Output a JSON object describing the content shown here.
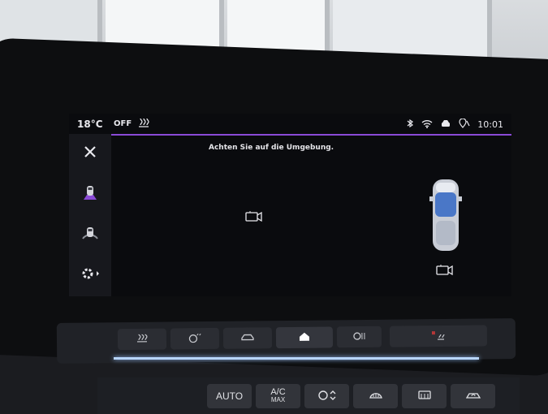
{
  "statusbar": {
    "temperature": "18°C",
    "mode": "OFF",
    "time": "10:01",
    "icons": [
      "seat-heat-icon",
      "bluetooth-icon",
      "wifi-icon",
      "car-connection-icon",
      "location-icon"
    ]
  },
  "sidebar": {
    "items": [
      {
        "icon": "close-icon"
      },
      {
        "icon": "car-front-icon"
      },
      {
        "icon": "parking-sensor-icon"
      },
      {
        "icon": "settings-icon"
      }
    ]
  },
  "main": {
    "message": "Achten Sie auf die Umgebung.",
    "icons": [
      "camera-icon",
      "car-top-view-icon",
      "camera-rear-icon"
    ]
  },
  "hvac": {
    "labels": [
      "AUTO",
      "A/C",
      "MAX"
    ]
  },
  "colors": {
    "accent": "#8a4ad6",
    "car_blue": "#4a77c7"
  }
}
